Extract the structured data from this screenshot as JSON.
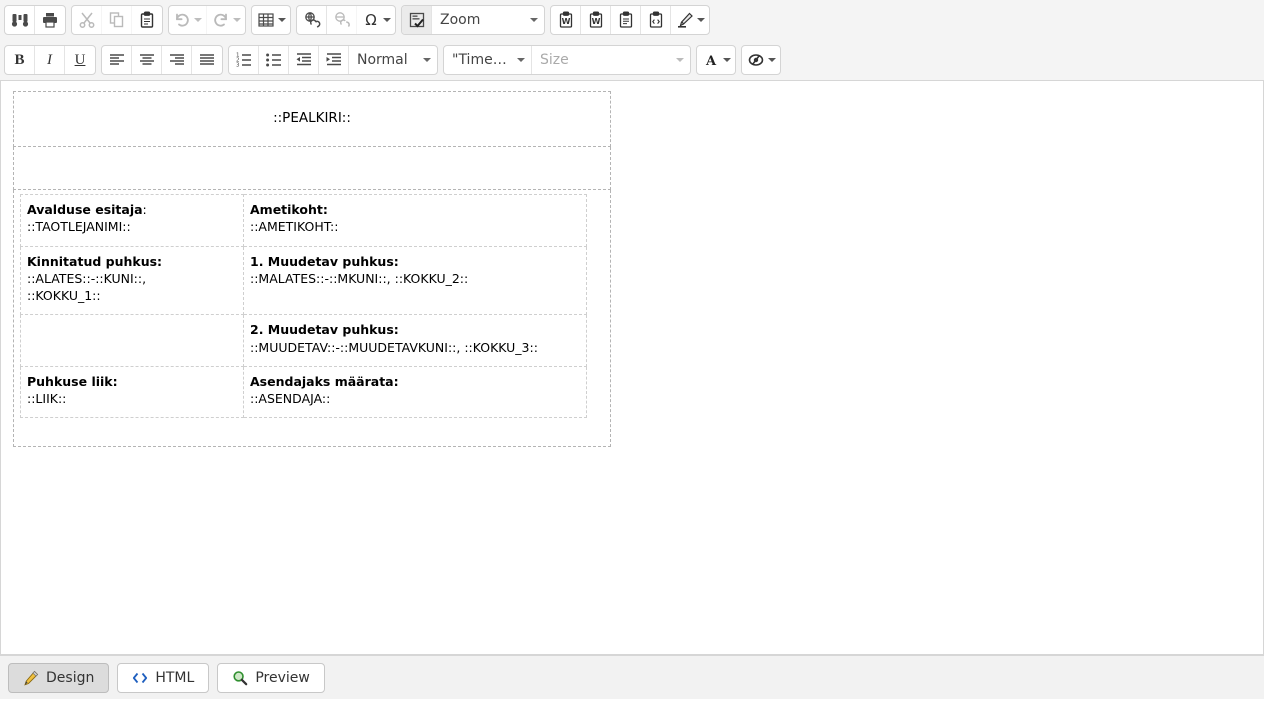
{
  "toolbar": {
    "row1": [
      {
        "group": [
          {
            "name": "find-icon",
            "title": "Find",
            "type": "icon",
            "icon": "binoculars",
            "state": "enabled"
          },
          {
            "name": "print-icon",
            "title": "Print",
            "type": "icon",
            "icon": "printer",
            "state": "enabled"
          }
        ]
      },
      {
        "group": [
          {
            "name": "cut-icon",
            "title": "Cut",
            "type": "icon",
            "icon": "scissors",
            "state": "disabled"
          },
          {
            "name": "copy-icon",
            "title": "Copy",
            "type": "icon",
            "icon": "copy",
            "state": "disabled"
          },
          {
            "name": "paste-icon",
            "title": "Paste",
            "type": "icon",
            "icon": "clipboard",
            "state": "enabled"
          }
        ]
      },
      {
        "group": [
          {
            "name": "undo-icon",
            "title": "Undo",
            "type": "icon-caret",
            "icon": "undo",
            "state": "disabled"
          },
          {
            "name": "redo-icon",
            "title": "Redo",
            "type": "icon-caret",
            "icon": "redo",
            "state": "disabled"
          }
        ]
      },
      {
        "group": [
          {
            "name": "table-icon",
            "title": "Table",
            "type": "icon-caret",
            "icon": "table",
            "state": "enabled"
          }
        ]
      },
      {
        "group": [
          {
            "name": "insert-link-icon",
            "title": "Insert link",
            "type": "icon",
            "icon": "link",
            "state": "enabled"
          },
          {
            "name": "remove-link-icon",
            "title": "Remove link",
            "type": "icon",
            "icon": "unlink",
            "state": "disabled"
          },
          {
            "name": "special-character-icon",
            "title": "Special character",
            "type": "icon-caret",
            "icon": "omega",
            "state": "enabled"
          }
        ]
      },
      {
        "group": [
          {
            "name": "insert-field-icon",
            "title": "Insert field",
            "type": "icon",
            "icon": "field",
            "state": "active"
          },
          {
            "name": "zoom-select",
            "title": "Zoom",
            "type": "combo",
            "variant": "zoom",
            "value": "Zoom"
          }
        ]
      },
      {
        "group": [
          {
            "name": "paste-from-word-icon",
            "title": "Paste from Word",
            "type": "icon",
            "icon": "word-clip",
            "state": "enabled"
          },
          {
            "name": "paste-from-word-clean-icon",
            "title": "Paste from Word (clean)",
            "type": "icon",
            "icon": "word-clip",
            "state": "enabled"
          },
          {
            "name": "paste-plain-text-icon",
            "title": "Paste as plain text",
            "type": "icon",
            "icon": "text-clip",
            "state": "enabled"
          },
          {
            "name": "paste-html-icon",
            "title": "Paste as HTML",
            "type": "icon",
            "icon": "code-clip",
            "state": "enabled"
          },
          {
            "name": "format-painter-icon",
            "title": "Format painter",
            "type": "icon-caret",
            "icon": "brush",
            "state": "enabled"
          }
        ]
      }
    ],
    "row2": [
      {
        "group": [
          {
            "name": "bold-button",
            "title": "Bold",
            "type": "text",
            "label": "B",
            "style": "b"
          },
          {
            "name": "italic-button",
            "title": "Italic",
            "type": "text",
            "label": "I",
            "style": "i"
          },
          {
            "name": "underline-button",
            "title": "Underline",
            "type": "text",
            "label": "U",
            "style": "u"
          }
        ]
      },
      {
        "group": [
          {
            "name": "align-left-icon",
            "title": "Align left",
            "type": "icon",
            "icon": "align-left",
            "state": "enabled"
          },
          {
            "name": "align-center-icon",
            "title": "Align center",
            "type": "icon",
            "icon": "align-center",
            "state": "enabled"
          },
          {
            "name": "align-right-icon",
            "title": "Align right",
            "type": "icon",
            "icon": "align-right",
            "state": "enabled"
          },
          {
            "name": "align-justify-icon",
            "title": "Justify",
            "type": "icon",
            "icon": "align-justify",
            "state": "enabled"
          }
        ]
      },
      {
        "group": [
          {
            "name": "numbered-list-icon",
            "title": "Numbered list",
            "type": "icon",
            "icon": "ol",
            "state": "enabled"
          },
          {
            "name": "bulleted-list-icon",
            "title": "Bulleted list",
            "type": "icon",
            "icon": "ul",
            "state": "enabled"
          },
          {
            "name": "outdent-icon",
            "title": "Decrease indent",
            "type": "icon",
            "icon": "outdent",
            "state": "enabled"
          },
          {
            "name": "indent-icon",
            "title": "Increase indent",
            "type": "icon",
            "icon": "indent",
            "state": "enabled"
          },
          {
            "name": "paragraph-format-select",
            "title": "Paragraph format",
            "type": "combo",
            "variant": "para",
            "value": "Normal"
          }
        ]
      },
      {
        "group": [
          {
            "name": "font-family-select",
            "title": "Font family",
            "type": "combo",
            "variant": "font",
            "value": "\"Times N..."
          },
          {
            "name": "font-size-select",
            "title": "Font size",
            "type": "combo",
            "variant": "size",
            "value": "Size"
          }
        ]
      },
      {
        "group": [
          {
            "name": "text-color-button",
            "title": "Text color",
            "type": "icon-caret",
            "icon": "fontcolor",
            "state": "enabled"
          }
        ]
      },
      {
        "group": [
          {
            "name": "background-color-button",
            "title": "Background color",
            "type": "icon-caret",
            "icon": "bgcolor",
            "state": "enabled"
          }
        ]
      }
    ]
  },
  "document": {
    "title_placeholder": "::PEALKIRI::",
    "rows": [
      {
        "left_label": "Avalduse esitaja",
        "left_label_suffix": ":",
        "left_value": "::TAOTLEJANIMI::",
        "right_label": "Ametikoht:",
        "right_value": "::AMETIKOHT::"
      },
      {
        "left_label": "Kinnitatud puhkus:",
        "left_value_line1": "::ALATES::-::KUNI::,",
        "left_value_line2": "::KOKKU_1::",
        "right_label": "1. Muudetav puhkus:",
        "right_value": "::MALATES::-::MKUNI::, ::KOKKU_2::"
      },
      {
        "left_label": "",
        "left_value": "",
        "right_label": "2. Muudetav puhkus:",
        "right_value": "::MUUDETAV::-::MUUDETAVKUNI::, ::KOKKU_3::"
      },
      {
        "left_label": "Puhkuse liik:",
        "left_value": "::LIIK::",
        "right_label": "Asendajaks määrata:",
        "right_value": "::ASENDAJA::"
      }
    ]
  },
  "tabs": [
    {
      "name": "tab-design",
      "label": "Design",
      "icon": "pencil",
      "active": true
    },
    {
      "name": "tab-html",
      "label": "HTML",
      "icon": "code",
      "active": false
    },
    {
      "name": "tab-preview",
      "label": "Preview",
      "icon": "magnifier",
      "active": false
    }
  ],
  "colors": {
    "toolbar_bg": "#f4f4f4",
    "group_bg": "#ffffff",
    "border": "#d4d4d4",
    "icon": "#4a4a4a",
    "tab_active_bg": "#dcdcdc",
    "table_border_outer": "#b4b4b4",
    "table_border_inner": "#cfcfcf",
    "html_icon": "#1f5fbf",
    "preview_icon": "#2f8f2f",
    "pencil_icon": "#e0a020"
  }
}
